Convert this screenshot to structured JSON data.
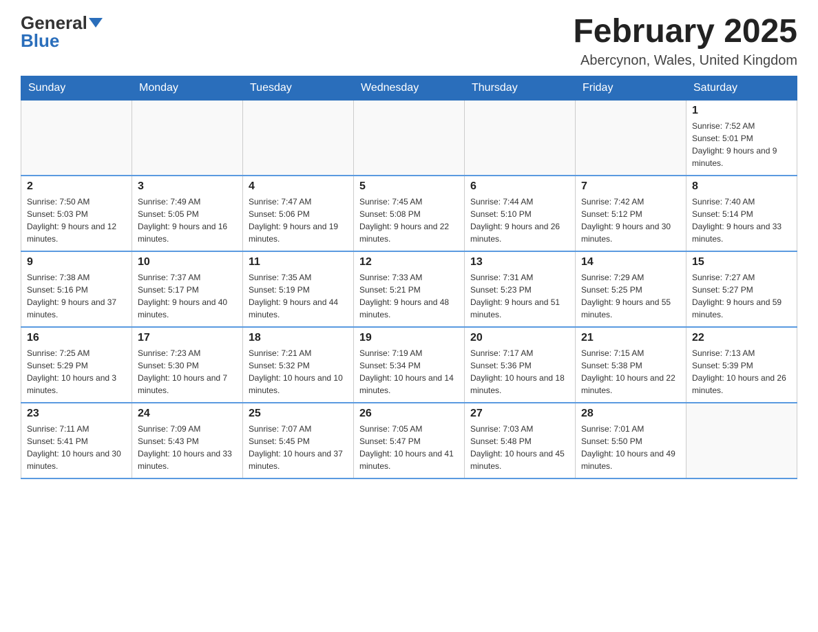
{
  "header": {
    "logo_general": "General",
    "logo_blue": "Blue",
    "month_year": "February 2025",
    "location": "Abercynon, Wales, United Kingdom"
  },
  "days_of_week": [
    "Sunday",
    "Monday",
    "Tuesday",
    "Wednesday",
    "Thursday",
    "Friday",
    "Saturday"
  ],
  "weeks": [
    [
      {
        "day": "",
        "sunrise": "",
        "sunset": "",
        "daylight": ""
      },
      {
        "day": "",
        "sunrise": "",
        "sunset": "",
        "daylight": ""
      },
      {
        "day": "",
        "sunrise": "",
        "sunset": "",
        "daylight": ""
      },
      {
        "day": "",
        "sunrise": "",
        "sunset": "",
        "daylight": ""
      },
      {
        "day": "",
        "sunrise": "",
        "sunset": "",
        "daylight": ""
      },
      {
        "day": "",
        "sunrise": "",
        "sunset": "",
        "daylight": ""
      },
      {
        "day": "1",
        "sunrise": "Sunrise: 7:52 AM",
        "sunset": "Sunset: 5:01 PM",
        "daylight": "Daylight: 9 hours and 9 minutes."
      }
    ],
    [
      {
        "day": "2",
        "sunrise": "Sunrise: 7:50 AM",
        "sunset": "Sunset: 5:03 PM",
        "daylight": "Daylight: 9 hours and 12 minutes."
      },
      {
        "day": "3",
        "sunrise": "Sunrise: 7:49 AM",
        "sunset": "Sunset: 5:05 PM",
        "daylight": "Daylight: 9 hours and 16 minutes."
      },
      {
        "day": "4",
        "sunrise": "Sunrise: 7:47 AM",
        "sunset": "Sunset: 5:06 PM",
        "daylight": "Daylight: 9 hours and 19 minutes."
      },
      {
        "day": "5",
        "sunrise": "Sunrise: 7:45 AM",
        "sunset": "Sunset: 5:08 PM",
        "daylight": "Daylight: 9 hours and 22 minutes."
      },
      {
        "day": "6",
        "sunrise": "Sunrise: 7:44 AM",
        "sunset": "Sunset: 5:10 PM",
        "daylight": "Daylight: 9 hours and 26 minutes."
      },
      {
        "day": "7",
        "sunrise": "Sunrise: 7:42 AM",
        "sunset": "Sunset: 5:12 PM",
        "daylight": "Daylight: 9 hours and 30 minutes."
      },
      {
        "day": "8",
        "sunrise": "Sunrise: 7:40 AM",
        "sunset": "Sunset: 5:14 PM",
        "daylight": "Daylight: 9 hours and 33 minutes."
      }
    ],
    [
      {
        "day": "9",
        "sunrise": "Sunrise: 7:38 AM",
        "sunset": "Sunset: 5:16 PM",
        "daylight": "Daylight: 9 hours and 37 minutes."
      },
      {
        "day": "10",
        "sunrise": "Sunrise: 7:37 AM",
        "sunset": "Sunset: 5:17 PM",
        "daylight": "Daylight: 9 hours and 40 minutes."
      },
      {
        "day": "11",
        "sunrise": "Sunrise: 7:35 AM",
        "sunset": "Sunset: 5:19 PM",
        "daylight": "Daylight: 9 hours and 44 minutes."
      },
      {
        "day": "12",
        "sunrise": "Sunrise: 7:33 AM",
        "sunset": "Sunset: 5:21 PM",
        "daylight": "Daylight: 9 hours and 48 minutes."
      },
      {
        "day": "13",
        "sunrise": "Sunrise: 7:31 AM",
        "sunset": "Sunset: 5:23 PM",
        "daylight": "Daylight: 9 hours and 51 minutes."
      },
      {
        "day": "14",
        "sunrise": "Sunrise: 7:29 AM",
        "sunset": "Sunset: 5:25 PM",
        "daylight": "Daylight: 9 hours and 55 minutes."
      },
      {
        "day": "15",
        "sunrise": "Sunrise: 7:27 AM",
        "sunset": "Sunset: 5:27 PM",
        "daylight": "Daylight: 9 hours and 59 minutes."
      }
    ],
    [
      {
        "day": "16",
        "sunrise": "Sunrise: 7:25 AM",
        "sunset": "Sunset: 5:29 PM",
        "daylight": "Daylight: 10 hours and 3 minutes."
      },
      {
        "day": "17",
        "sunrise": "Sunrise: 7:23 AM",
        "sunset": "Sunset: 5:30 PM",
        "daylight": "Daylight: 10 hours and 7 minutes."
      },
      {
        "day": "18",
        "sunrise": "Sunrise: 7:21 AM",
        "sunset": "Sunset: 5:32 PM",
        "daylight": "Daylight: 10 hours and 10 minutes."
      },
      {
        "day": "19",
        "sunrise": "Sunrise: 7:19 AM",
        "sunset": "Sunset: 5:34 PM",
        "daylight": "Daylight: 10 hours and 14 minutes."
      },
      {
        "day": "20",
        "sunrise": "Sunrise: 7:17 AM",
        "sunset": "Sunset: 5:36 PM",
        "daylight": "Daylight: 10 hours and 18 minutes."
      },
      {
        "day": "21",
        "sunrise": "Sunrise: 7:15 AM",
        "sunset": "Sunset: 5:38 PM",
        "daylight": "Daylight: 10 hours and 22 minutes."
      },
      {
        "day": "22",
        "sunrise": "Sunrise: 7:13 AM",
        "sunset": "Sunset: 5:39 PM",
        "daylight": "Daylight: 10 hours and 26 minutes."
      }
    ],
    [
      {
        "day": "23",
        "sunrise": "Sunrise: 7:11 AM",
        "sunset": "Sunset: 5:41 PM",
        "daylight": "Daylight: 10 hours and 30 minutes."
      },
      {
        "day": "24",
        "sunrise": "Sunrise: 7:09 AM",
        "sunset": "Sunset: 5:43 PM",
        "daylight": "Daylight: 10 hours and 33 minutes."
      },
      {
        "day": "25",
        "sunrise": "Sunrise: 7:07 AM",
        "sunset": "Sunset: 5:45 PM",
        "daylight": "Daylight: 10 hours and 37 minutes."
      },
      {
        "day": "26",
        "sunrise": "Sunrise: 7:05 AM",
        "sunset": "Sunset: 5:47 PM",
        "daylight": "Daylight: 10 hours and 41 minutes."
      },
      {
        "day": "27",
        "sunrise": "Sunrise: 7:03 AM",
        "sunset": "Sunset: 5:48 PM",
        "daylight": "Daylight: 10 hours and 45 minutes."
      },
      {
        "day": "28",
        "sunrise": "Sunrise: 7:01 AM",
        "sunset": "Sunset: 5:50 PM",
        "daylight": "Daylight: 10 hours and 49 minutes."
      },
      {
        "day": "",
        "sunrise": "",
        "sunset": "",
        "daylight": ""
      }
    ]
  ]
}
